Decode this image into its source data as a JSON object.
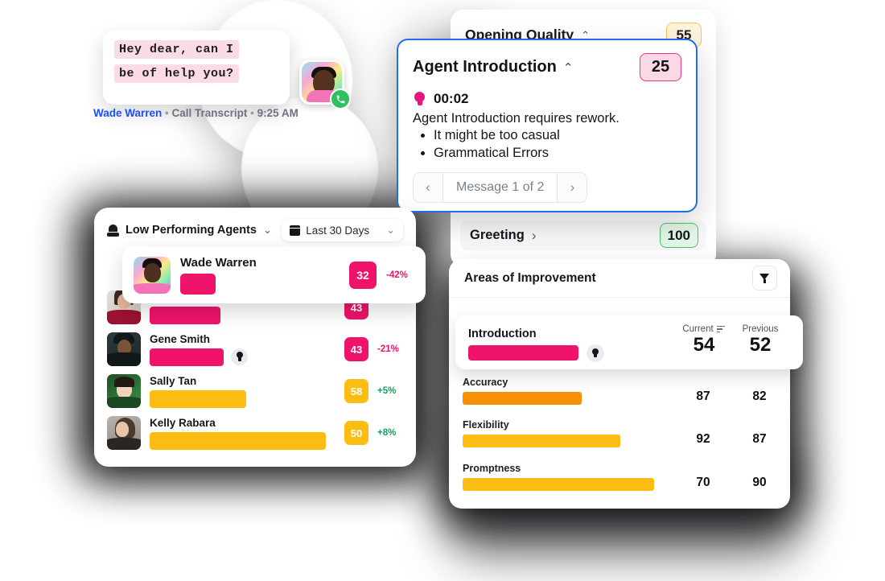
{
  "transcript": {
    "lines": [
      "Hey dear, can I",
      "be of help you?"
    ],
    "avatar_name": "wade-warren-avatar",
    "call_icon": "phone-icon",
    "caption_name": "Wade Warren",
    "caption_sep1": "•",
    "caption_source": "Call Transcript",
    "caption_sep2": "•",
    "caption_time": "9:25 AM"
  },
  "opening_quality": {
    "title": "Opening Quality",
    "chevron": "⌃",
    "score": "55",
    "greeting": {
      "title": "Greeting",
      "chevron": "›",
      "score": "100"
    }
  },
  "agent_introduction": {
    "title": "Agent Introduction",
    "chevron": "⌃",
    "score": "25",
    "timestamp": "00:02",
    "description": "Agent Introduction requires rework.",
    "bullets": [
      "It might be too casual",
      "Grammatical Errors"
    ],
    "nav": {
      "prev": "‹",
      "label": "Message 1 of 2",
      "next": "›"
    }
  },
  "low_performing_agents": {
    "title": "Low Performing Agents",
    "title_chevron": "⌄",
    "date_filter_label": "Last 30 Days",
    "date_filter_chevron": "⌄",
    "rows": [
      {
        "name": "Wade Warren",
        "score": "32",
        "delta": "-42%",
        "delta_dir": "down",
        "bar_pct": 22,
        "color": "pink",
        "floating": true
      },
      {
        "name": "",
        "score": "43",
        "delta": "",
        "delta_dir": "none",
        "bar_pct": 38,
        "color": "pink",
        "obscured": true
      },
      {
        "name": "Gene Smith",
        "score": "43",
        "delta": "-21%",
        "delta_dir": "down",
        "bar_pct": 40,
        "color": "pink"
      },
      {
        "name": "Sally Tan",
        "score": "58",
        "delta": "+5%",
        "delta_dir": "up",
        "bar_pct": 52,
        "color": "amber"
      },
      {
        "name": "Kelly Rabara",
        "score": "50",
        "delta": "+8%",
        "delta_dir": "up",
        "bar_pct": 95,
        "color": "amber"
      }
    ]
  },
  "areas_of_improvement": {
    "title": "Areas of Improvement",
    "filter_icon": "funnel-icon",
    "columns": {
      "current": "Current",
      "previous": "Previous",
      "sort_icon": "sort-icon"
    },
    "highlighted": {
      "name": "Introduction",
      "current": "54",
      "previous": "52",
      "bar_pct": 53,
      "color": "pink",
      "bulb_icon": "lightbulb-icon"
    },
    "rows": [
      {
        "name": "Accuracy",
        "current": "87",
        "previous": "82",
        "bar_pct": 56,
        "color": "orange"
      },
      {
        "name": "Flexibility",
        "current": "92",
        "previous": "87",
        "bar_pct": 76,
        "color": "amber"
      },
      {
        "name": "Promptness",
        "current": "70",
        "previous": "90",
        "bar_pct": 89,
        "color": "amber"
      }
    ]
  },
  "colors": {
    "pink": "#F0136B",
    "amber": "#FBBC13",
    "orange": "#F79009",
    "green": "#14A05A",
    "blue_focus": "#1F6FEB",
    "link_blue": "#1B4FFF",
    "transcript_highlight": "#FADBE6"
  }
}
